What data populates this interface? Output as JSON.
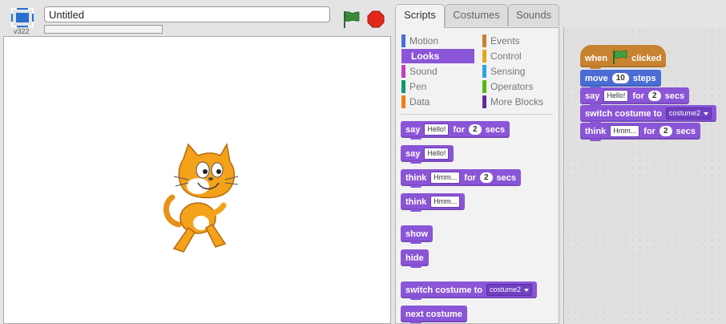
{
  "project": {
    "title": "Untitled",
    "version": "v322"
  },
  "tabs": [
    "Scripts",
    "Costumes",
    "Sounds"
  ],
  "categories": {
    "left": [
      {
        "label": "Motion",
        "color": "#4a6cd4"
      },
      {
        "label": "Looks",
        "color": "#8a55d7"
      },
      {
        "label": "Sound",
        "color": "#bb42c3"
      },
      {
        "label": "Pen",
        "color": "#0e9a6c"
      },
      {
        "label": "Data",
        "color": "#ee7d16"
      }
    ],
    "right": [
      {
        "label": "Events",
        "color": "#c88330"
      },
      {
        "label": "Control",
        "color": "#e1a91a"
      },
      {
        "label": "Sensing",
        "color": "#2ca5e2"
      },
      {
        "label": "Operators",
        "color": "#5cb712"
      },
      {
        "label": "More Blocks",
        "color": "#632d99"
      }
    ],
    "selected": "Looks"
  },
  "palette_blocks": {
    "say_secs": {
      "say": "say",
      "msg": "Hello!",
      "for": "for",
      "num": "2",
      "secs": "secs"
    },
    "say": {
      "say": "say",
      "msg": "Hello!"
    },
    "think_secs": {
      "think": "think",
      "msg": "Hmm...",
      "for": "for",
      "num": "2",
      "secs": "secs"
    },
    "think": {
      "think": "think",
      "msg": "Hmm..."
    },
    "show": "show",
    "hide": "hide",
    "switch_costume": {
      "label": "switch costume to",
      "value": "costume2"
    },
    "next_costume": "next costume"
  },
  "script_blocks": {
    "when_flag": {
      "when": "when",
      "clicked": "clicked"
    },
    "move": {
      "move": "move",
      "num": "10",
      "steps": "steps"
    },
    "say_secs": {
      "say": "say",
      "msg": "Hello!",
      "for": "for",
      "num": "2",
      "secs": "secs"
    },
    "switch_costume": {
      "label": "switch costume to",
      "value": "costume2"
    },
    "think_secs": {
      "think": "think",
      "msg": "Hmm...",
      "for": "for",
      "num": "2",
      "secs": "secs"
    }
  },
  "colors": {
    "looks": "#8a55d7",
    "motion": "#4a6cd4",
    "events": "#c88330",
    "flag": "#3a8a3a",
    "stop": "#e0291c"
  }
}
